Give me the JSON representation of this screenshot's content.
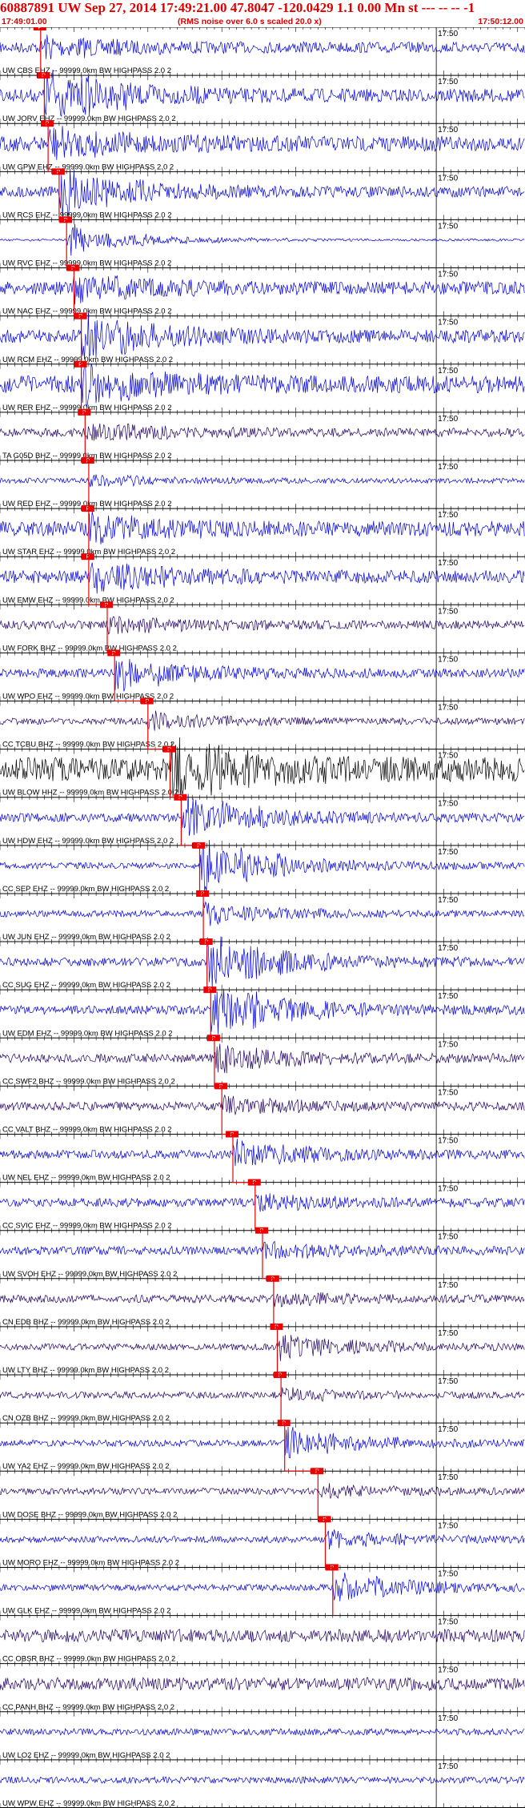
{
  "header": {
    "title": "60887891 UW Sep 27, 2014 17:49:21.00   47.8047 -120.0429  1.1 0.00 Mn st --- -- --  -1",
    "start_time": "17:49:01.00",
    "rms_note": "(RMS noise over 6.0 s scaled 20.0 x)",
    "end_time": "17:50:12.00"
  },
  "chart_data": {
    "type": "seismogram-record-section",
    "x_range": [
      "17:49:01.00",
      "17:50:12.00"
    ],
    "minute_mark_label": "17:50",
    "pick_label": "P",
    "colors": {
      "blue": "#0000dd",
      "navy": "#220066",
      "black": "#000000",
      "red": "#ee0000"
    },
    "traces": [
      {
        "label": "UW CBS EHZ -- 99999.0km BW  HIGHPASS  2.0  2",
        "color": "blue",
        "pick": "17:49:06.5",
        "amp": 0.25,
        "burst": 0.35
      },
      {
        "label": "UW JORV EHZ -- 99999.0km BW  HIGHPASS  2.0  2",
        "color": "blue",
        "pick": "17:49:07.0",
        "amp": 0.3,
        "burst": 0.95
      },
      {
        "label": "UW GPW EHZ -- 99999.0km BW  HIGHPASS  2.0  2",
        "color": "blue",
        "pick": "17:49:07.5",
        "amp": 0.35,
        "burst": 0.5
      },
      {
        "label": "UW RCS EHZ -- 99999.0km BW  HIGHPASS  2.0  2",
        "color": "blue",
        "pick": "17:49:09.0",
        "amp": 0.25,
        "burst": 0.8
      },
      {
        "label": "UW RVC EHZ -- 99999.0km BW  HIGHPASS  2.0  2",
        "color": "blue",
        "pick": "17:49:10.0",
        "amp": 0.05,
        "burst": 0.6
      },
      {
        "label": "UW NAC EHZ -- 99999.0km BW  HIGHPASS  2.0  2",
        "color": "blue",
        "pick": "17:49:11.0",
        "amp": 0.3,
        "burst": 0.45
      },
      {
        "label": "UW RCM EHZ -- 99999.0km BW  HIGHPASS  2.0  2",
        "color": "blue",
        "pick": "17:49:12.0",
        "amp": 0.3,
        "burst": 0.8
      },
      {
        "label": "UW RER EHZ -- 99999.0km BW  HIGHPASS  2.0  2",
        "color": "blue",
        "pick": "17:49:12.0",
        "amp": 0.4,
        "burst": 0.55
      },
      {
        "label": "TA G05D BHZ -- 99999.0km BW  HIGHPASS  2.0  2",
        "color": "navy",
        "pick": "17:49:12.5",
        "amp": 0.2,
        "burst": 0.3
      },
      {
        "label": "UW RED EHZ -- 99999.0km BW  HIGHPASS  2.0  2",
        "color": "blue",
        "pick": "17:49:13.0",
        "amp": 0.12,
        "burst": 0.2
      },
      {
        "label": "UW STAR EHZ -- 99999.0km BW  HIGHPASS  2.0  2",
        "color": "blue",
        "pick": "17:49:13.0",
        "amp": 0.35,
        "burst": 0.4
      },
      {
        "label": "UW EMW EHZ -- 99999.0km BW  HIGHPASS  2.0  2",
        "color": "blue",
        "pick": "17:49:13.0",
        "amp": 0.3,
        "burst": 0.5
      },
      {
        "label": "UW FORK BHZ -- 99999.0km BW  HIGHPASS  2.0  2",
        "color": "navy",
        "pick": "17:49:15.5",
        "amp": 0.2,
        "burst": 0.25
      },
      {
        "label": "UW WPO EHZ -- 99999.0km BW  HIGHPASS  2.0  2",
        "color": "blue",
        "pick": "17:49:16.5",
        "amp": 0.2,
        "burst": 0.6
      },
      {
        "label": "CC TCBU BHZ -- 99999.0km BW  HIGHPASS  2.0  2",
        "color": "navy",
        "pick": "17:49:21.0",
        "amp": 0.15,
        "burst": 0.3
      },
      {
        "label": "UW BLOW HHZ -- 99999.0km BW  HIGHPASS  2.0  2",
        "color": "black",
        "pick": "17:49:24.0",
        "amp": 0.55,
        "burst": 0.95
      },
      {
        "label": "UW HDW EHZ -- 99999.0km BW  HIGHPASS  2.0  2",
        "color": "blue",
        "pick": "17:49:25.5",
        "amp": 0.2,
        "burst": 0.8
      },
      {
        "label": "CC SEP EHZ -- 99999.0km BW  HIGHPASS  2.0  2",
        "color": "blue",
        "pick": "17:49:28.0",
        "amp": 0.15,
        "burst": 1.0
      },
      {
        "label": "UW JUN EHZ -- 99999.0km BW  HIGHPASS  2.0  2",
        "color": "blue",
        "pick": "17:49:28.5",
        "amp": 0.15,
        "burst": 0.4
      },
      {
        "label": "CC SUG EHZ -- 99999.0km BW  HIGHPASS  2.0  2",
        "color": "blue",
        "pick": "17:49:29.0",
        "amp": 0.2,
        "burst": 1.0
      },
      {
        "label": "UW EDM EHZ -- 99999.0km BW  HIGHPASS  2.0  2",
        "color": "blue",
        "pick": "17:49:29.5",
        "amp": 0.2,
        "burst": 1.0
      },
      {
        "label": "CC SWF2 BHZ -- 99999.0km BW  HIGHPASS  2.0  2",
        "color": "navy",
        "pick": "17:49:30.0",
        "amp": 0.2,
        "burst": 0.5
      },
      {
        "label": "CC VALT BHZ -- 99999.0km BW  HIGHPASS  2.0  2",
        "color": "navy",
        "pick": "17:49:31.0",
        "amp": 0.2,
        "burst": 0.3
      },
      {
        "label": "UW NEL EHZ -- 99999.0km BW  HIGHPASS  2.0  2",
        "color": "blue",
        "pick": "17:49:32.5",
        "amp": 0.2,
        "burst": 0.5
      },
      {
        "label": "CC SVIC EHZ -- 99999.0km BW  HIGHPASS  2.0  2",
        "color": "blue",
        "pick": "17:49:35.5",
        "amp": 0.2,
        "burst": 0.25
      },
      {
        "label": "UW SVOH EHZ -- 99999.0km BW  HIGHPASS  2.0  2",
        "color": "blue",
        "pick": "17:49:36.5",
        "amp": 0.2,
        "burst": 0.25
      },
      {
        "label": "CN EDB BHZ -- 99999.0km BW  HIGHPASS  2.0  2",
        "color": "navy",
        "pick": "17:49:38.0",
        "amp": 0.18,
        "burst": 0.2
      },
      {
        "label": "UW LTY BHZ -- 99999.0km BW  HIGHPASS  2.0  2",
        "color": "navy",
        "pick": "17:49:38.5",
        "amp": 0.15,
        "burst": 0.5
      },
      {
        "label": "CN OZB BHZ -- 99999.0km BW  HIGHPASS  2.0  2",
        "color": "navy",
        "pick": "17:49:39.0",
        "amp": 0.15,
        "burst": 0.2
      },
      {
        "label": "UW YA2 EHZ -- 99999.0km BW  HIGHPASS  2.0  2",
        "color": "blue",
        "pick": "17:49:39.5",
        "amp": 0.15,
        "burst": 0.55
      },
      {
        "label": "UW DOSE BHZ -- 99999.0km BW  HIGHPASS  2.0  2",
        "color": "navy",
        "pick": "17:49:44.0",
        "amp": 0.15,
        "burst": 0.25
      },
      {
        "label": "UW MORO EHZ -- 99999.0km BW  HIGHPASS  2.0  2",
        "color": "blue",
        "pick": "17:49:45.0",
        "amp": 0.15,
        "burst": 0.3
      },
      {
        "label": "UW GLK EHZ -- 99999.0km BW  HIGHPASS  2.0  2",
        "color": "blue",
        "pick": "17:49:46.0",
        "amp": 0.15,
        "burst": 0.55
      },
      {
        "label": "CC OBSR BHZ -- 99999.0km BW  HIGHPASS  2.0  2",
        "color": "navy",
        "pick": "",
        "amp": 0.3,
        "burst": 0.0
      },
      {
        "label": "CC PANH BHZ -- 99999.0km BW  HIGHPASS  2.0  2",
        "color": "navy",
        "pick": "",
        "amp": 0.3,
        "burst": 0.0
      },
      {
        "label": "UW LO2 EHZ -- 99999.0km BW  HIGHPASS  2.0  2",
        "color": "blue",
        "pick": "",
        "amp": 0.15,
        "burst": 0.0
      },
      {
        "label": "UW WPW EHZ -- 99999.0km BW  HIGHPASS  2.0  2",
        "color": "blue",
        "pick": "",
        "amp": 0.15,
        "burst": 0.0
      }
    ]
  }
}
